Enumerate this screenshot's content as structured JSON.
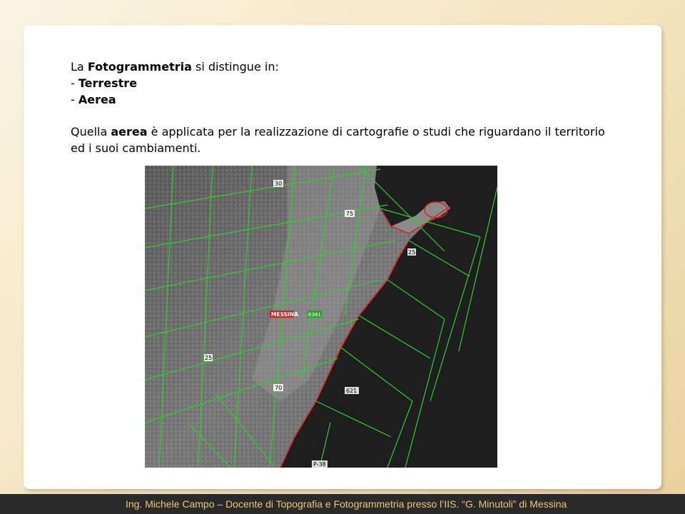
{
  "slide": {
    "intro_pre": "La ",
    "intro_bold": "Fotogrammetria",
    "intro_post": " si distingue in:",
    "item1_prefix": "- ",
    "item1": "Terrestre",
    "item2_prefix": "- ",
    "item2": "Aerea",
    "para_pre": "Quella ",
    "para_bold": "aerea",
    "para_post": " è applicata per la realizzazione di cartografie o studi che riguardano il territorio",
    "para_line2": "ed i suoi cambiamenti."
  },
  "map": {
    "labels": {
      "city": "MESSINA",
      "green_tag": "6381",
      "n30": "30",
      "n75": "75",
      "n25_right": "25",
      "n25_left": "25",
      "n70": "70",
      "n621": "621",
      "p38": "P-38"
    }
  },
  "footer": {
    "text": "Ing. Michele Campo – Docente di Topografia e Fotogrammetria presso l’IIS. “G. Minutoli” di Messina"
  },
  "colors": {
    "footer_text": "#e8c87a",
    "grid_lines": "#2bd12b",
    "coastline": "#e02020"
  }
}
